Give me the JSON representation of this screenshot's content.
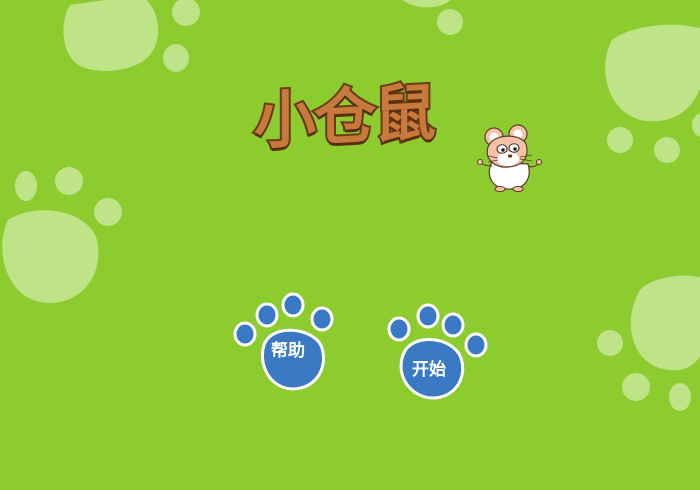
{
  "game": {
    "title": "小仓鼠"
  },
  "buttons": {
    "help_label": "帮助",
    "start_label": "开始"
  },
  "colors": {
    "background": "#8ccc2f",
    "background_paw": "#bfe387",
    "paw_button_fill": "#3a7ac4",
    "paw_button_outline": "#ffffff",
    "title_fill": "#c77a3c",
    "title_outline": "#6b3b16"
  },
  "icons": {
    "background_decor": "paw-print-icon",
    "mascot": "hamster-icon",
    "buttons": "paw-print-icon"
  }
}
